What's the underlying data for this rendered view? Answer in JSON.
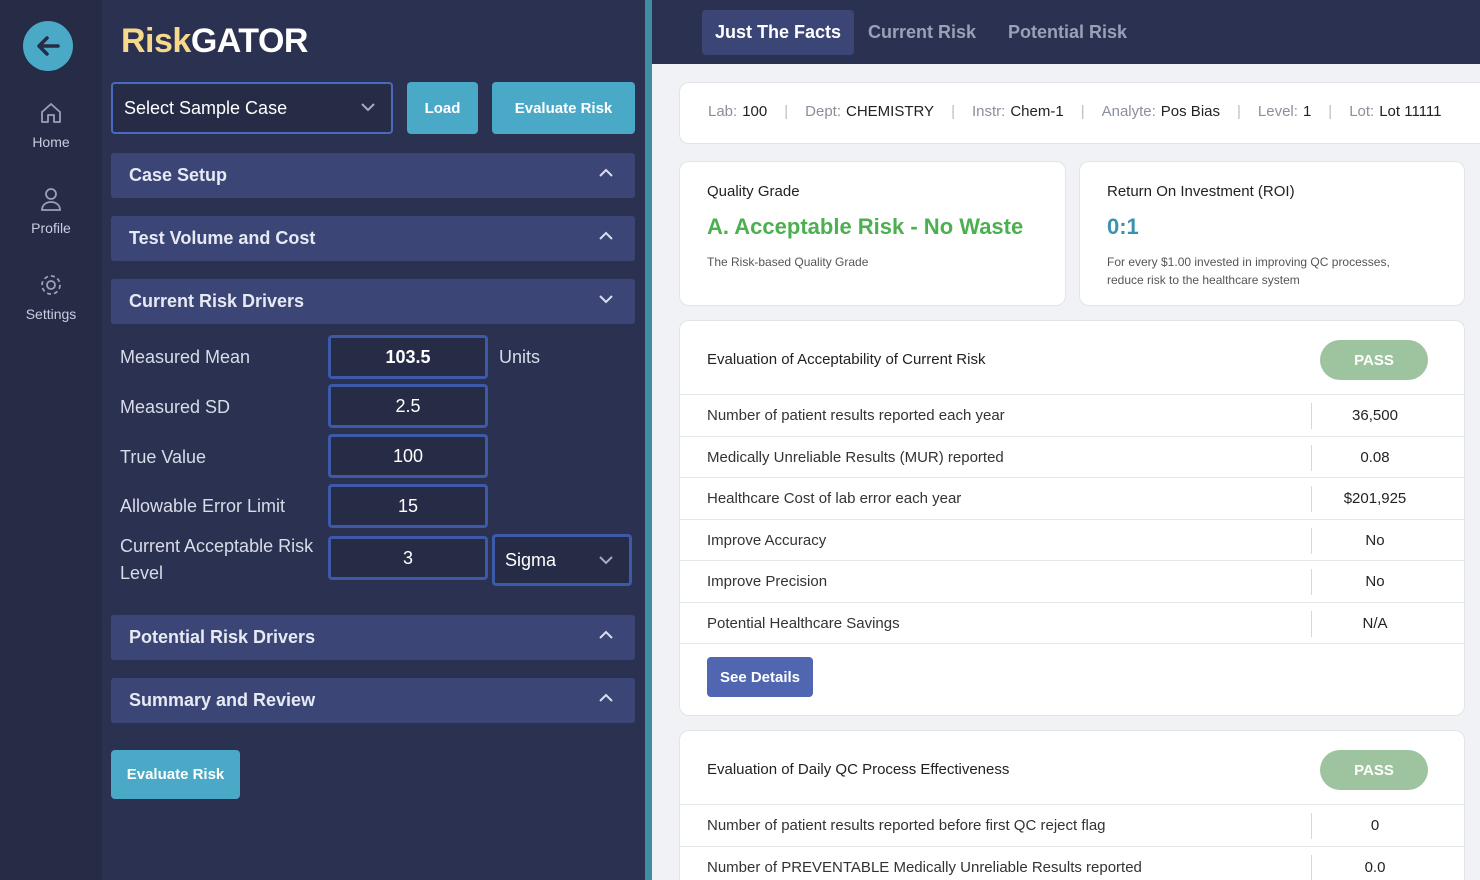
{
  "nav": {
    "back_icon": "arrow-left-icon",
    "items": [
      {
        "label": "Home",
        "icon": "home-icon"
      },
      {
        "label": "Profile",
        "icon": "user-icon"
      },
      {
        "label": "Settings",
        "icon": "gear-icon"
      }
    ]
  },
  "brand": {
    "part1": "Risk",
    "part2": "GATOR",
    "color1": "#f6d98a",
    "color2": "#ffffff"
  },
  "controls": {
    "sample_select": "Select Sample Case",
    "load_label": "Load",
    "evaluate_label": "Evaluate Risk",
    "evaluate_bottom_label": "Evaluate Risk"
  },
  "accordions": {
    "case_setup": "Case Setup",
    "test_volume": "Test Volume and Cost",
    "current_risk": "Current Risk Drivers",
    "potential_risk": "Potential Risk Drivers",
    "summary": "Summary and Review"
  },
  "fields": {
    "measured_mean": {
      "label": "Measured Mean",
      "value": "103.5",
      "unit": "Units"
    },
    "measured_sd": {
      "label": "Measured SD",
      "value": "2.5"
    },
    "true_value": {
      "label": "True Value",
      "value": "100"
    },
    "allowable_error": {
      "label": "Allowable Error Limit",
      "value": "15"
    },
    "acceptable_risk": {
      "label_line1": "Current Acceptable Risk",
      "label_line2": "Level",
      "value": "3",
      "unit_select": "Sigma"
    }
  },
  "tabs": [
    "Just The Facts",
    "Current Risk",
    "Potential Risk"
  ],
  "info": {
    "lab_label": "Lab:",
    "lab": "100",
    "dept_label": "Dept:",
    "dept": "CHEMISTRY",
    "instr_label": "Instr:",
    "instr": "Chem-1",
    "analyte_label": "Analyte:",
    "analyte": "Pos Bias",
    "level_label": "Level:",
    "level": "1",
    "lot_label": "Lot:",
    "lot": "Lot 11111"
  },
  "quality": {
    "title": "Quality Grade",
    "grade": "A. Acceptable Risk - No Waste",
    "desc": "The Risk-based Quality Grade",
    "grade_color": "#4caf50"
  },
  "roi": {
    "title": "Return On Investment (ROI)",
    "value": "0:1",
    "desc_line1": "For every $1.00 invested in improving QC processes,",
    "desc_line2": "reduce risk to the healthcare system"
  },
  "current_eval": {
    "title": "Evaluation of Acceptability of Current Risk",
    "status": "PASS",
    "rows": [
      {
        "label": "Number of patient results reported each year",
        "value": "36,500"
      },
      {
        "label": "Medically Unreliable Results (MUR) reported",
        "value": "0.08"
      },
      {
        "label": "Healthcare Cost of lab error each year",
        "value": "$201,925"
      },
      {
        "label": "Improve Accuracy",
        "value": "No"
      },
      {
        "label": "Improve Precision",
        "value": "No"
      },
      {
        "label": "Potential Healthcare Savings",
        "value": "N/A"
      }
    ],
    "details_label": "See Details"
  },
  "qc_eval": {
    "title": "Evaluation of Daily QC Process Effectiveness",
    "status": "PASS",
    "rows": [
      {
        "label": "Number of patient results reported before first QC reject flag",
        "value": "0"
      },
      {
        "label": "Number of PREVENTABLE Medically Unreliable Results reported",
        "value": "0.0"
      }
    ]
  }
}
